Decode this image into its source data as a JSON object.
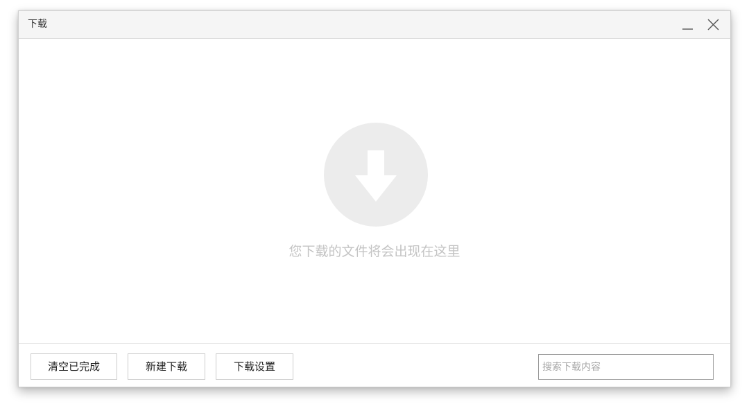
{
  "window": {
    "title": "下载"
  },
  "controls": {
    "minimize_icon": "minimize-icon",
    "close_icon": "close-icon"
  },
  "empty_state": {
    "icon": "download-arrow-icon",
    "message": "您下载的文件将会出现在这里"
  },
  "footer": {
    "clear_completed_label": "清空已完成",
    "new_download_label": "新建下载",
    "download_settings_label": "下载设置",
    "search_placeholder": "搜索下载内容",
    "search_value": ""
  },
  "colors": {
    "titlebar_bg": "#f5f5f5",
    "circle_bg": "#ececec",
    "message_text": "#c4c4c4",
    "button_border": "#cccccc",
    "search_border": "#9a9a9a"
  }
}
